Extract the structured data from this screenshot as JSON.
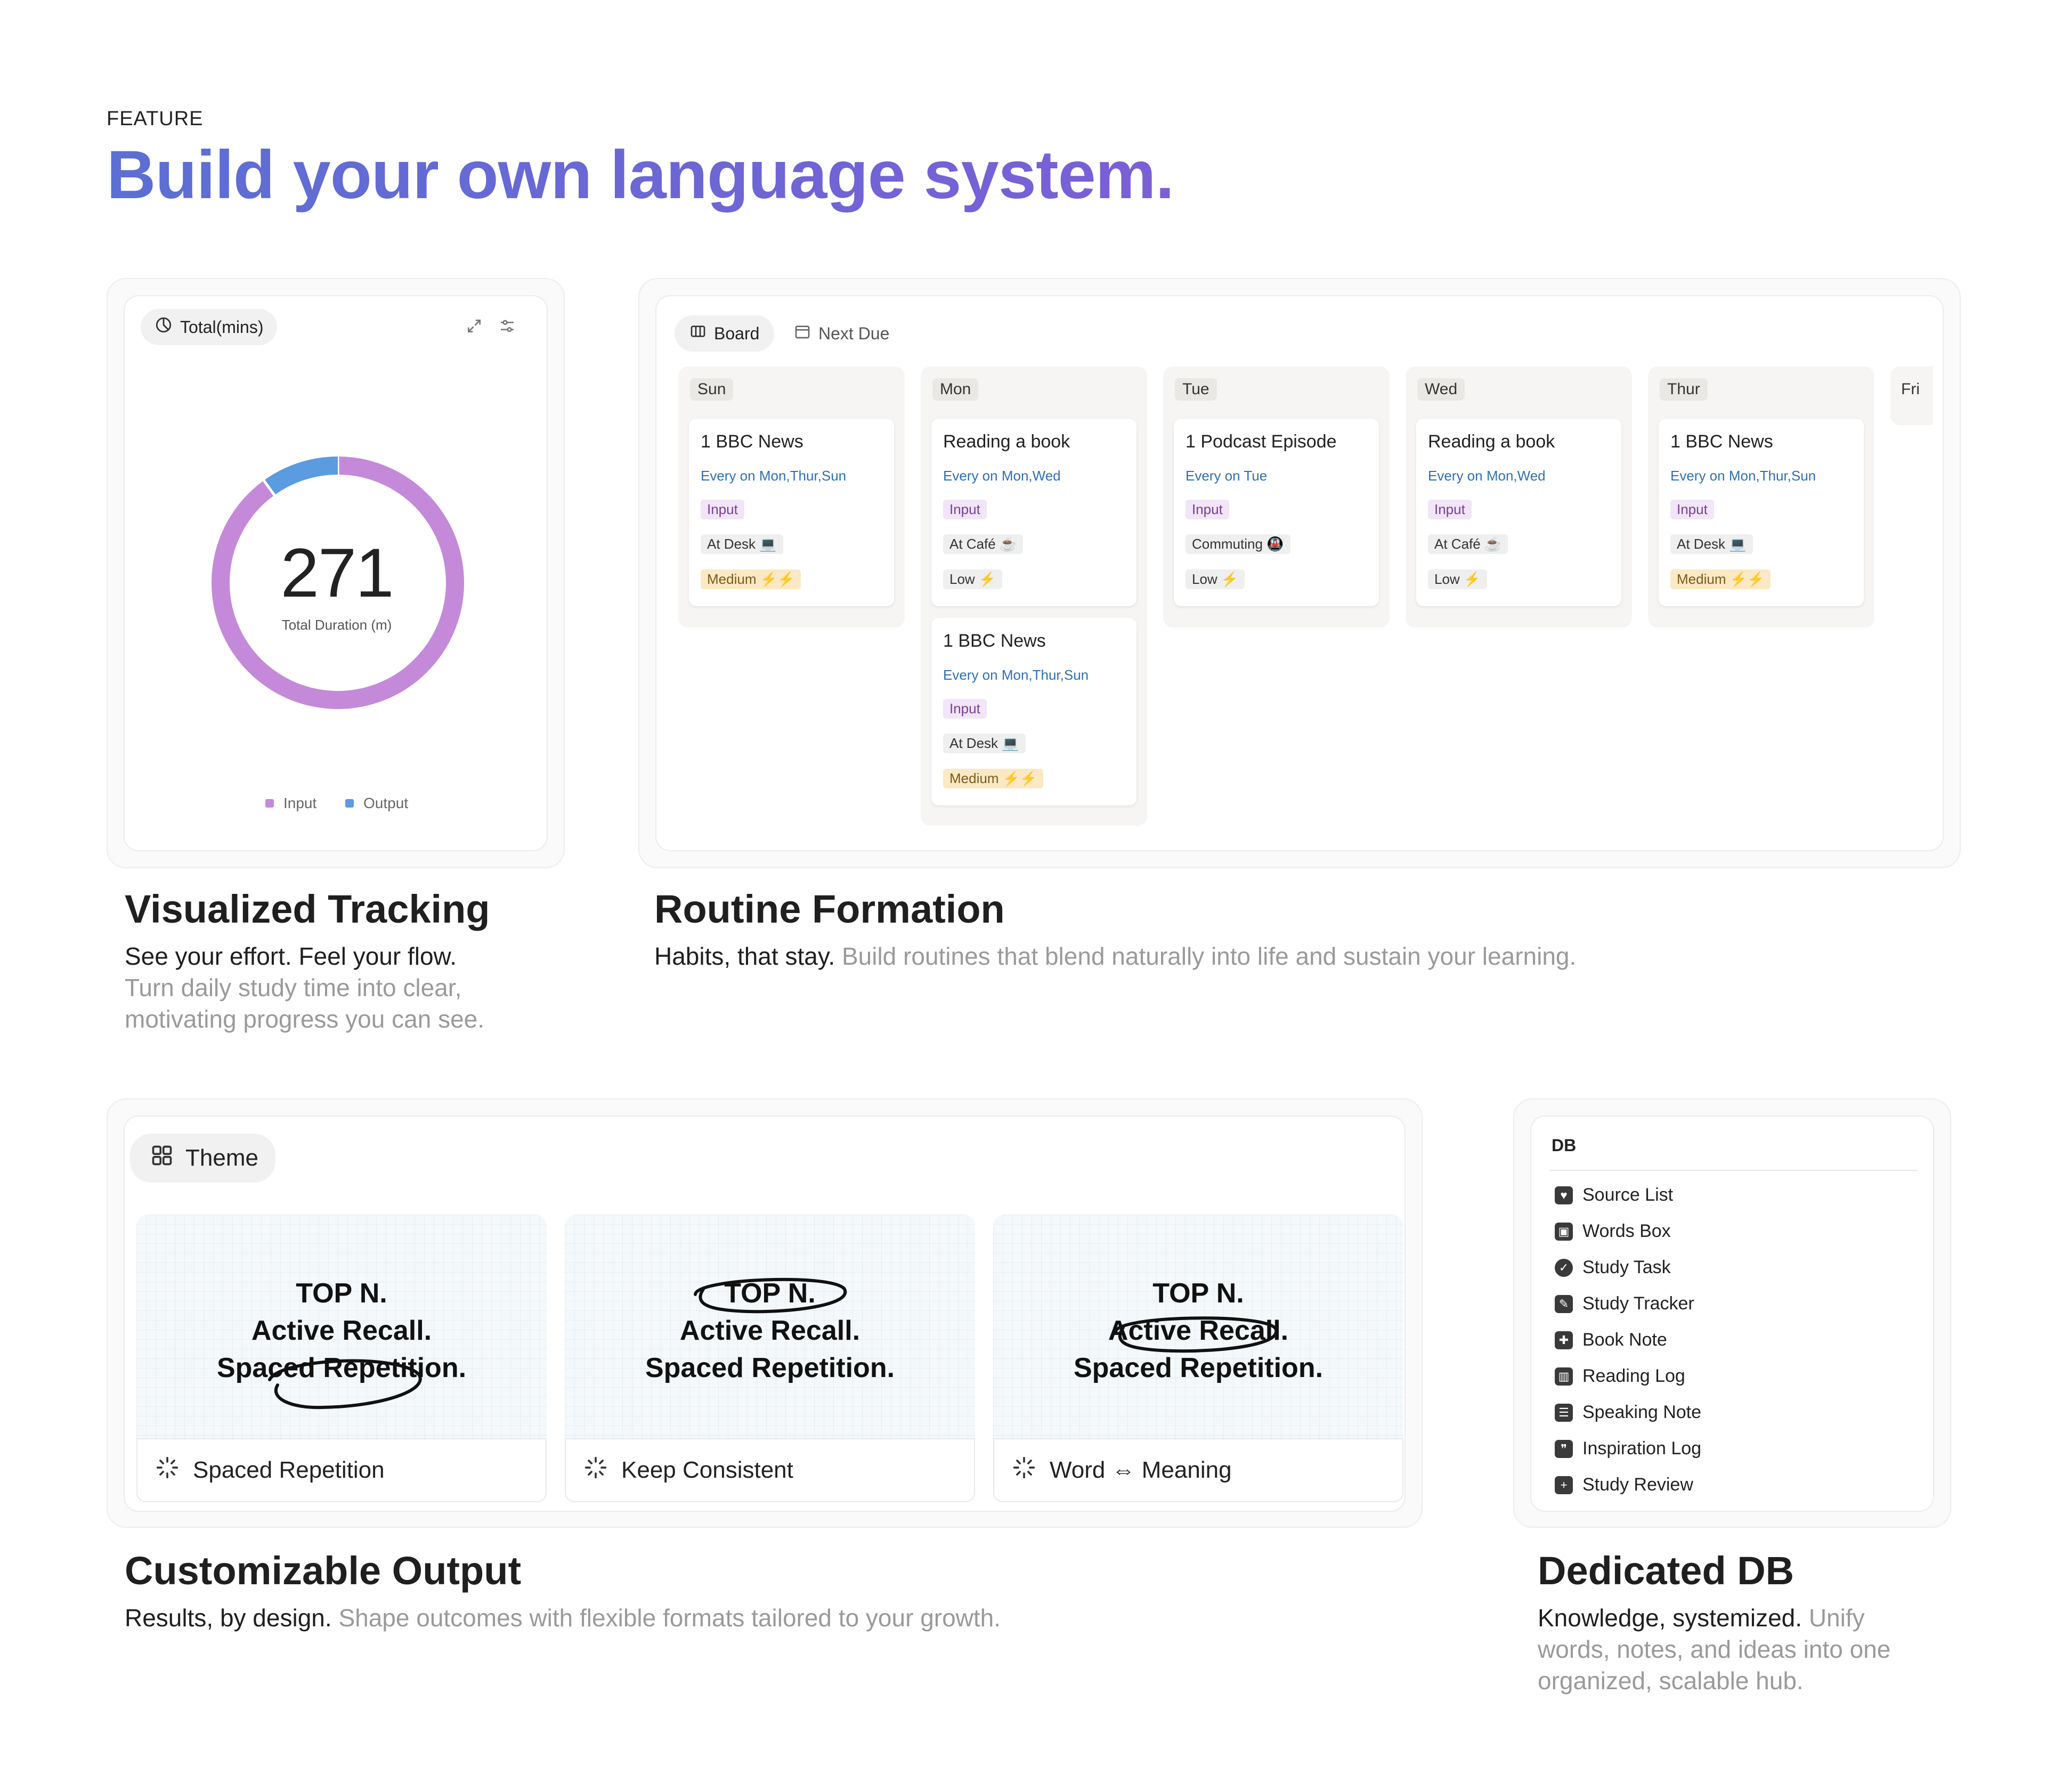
{
  "header": {
    "eyebrow": "FEATURE",
    "title": "Build your own language system."
  },
  "tracking": {
    "pill_label": "Total(mins)",
    "total_value": "271",
    "total_caption": "Total Duration (m)",
    "chart_data": {
      "type": "pie",
      "title": "",
      "categories": [
        "Input",
        "Output"
      ],
      "values": [
        244,
        27
      ],
      "colors": [
        "#c48ad9",
        "#5b9be0"
      ],
      "legend": "bottom",
      "total": 271
    },
    "legend": [
      {
        "label": "Input",
        "color": "#c48ad9"
      },
      {
        "label": "Output",
        "color": "#5b9be0"
      }
    ],
    "section_title": "Visualized Tracking",
    "lead": "See your effort. Feel your flow.",
    "body": "Turn daily study time into clear, motivating progress you can see."
  },
  "routine": {
    "tabs": [
      {
        "label": "Board",
        "active": true
      },
      {
        "label": "Next Due",
        "active": false
      }
    ],
    "columns": [
      {
        "day": "Sun",
        "cards": [
          {
            "title": "1 BBC News",
            "schedule": "Every on Mon,Thur,Sun",
            "type": "Input",
            "place": "At Desk 💻",
            "level": "Medium ⚡⚡",
            "level_kind": "med"
          }
        ]
      },
      {
        "day": "Mon",
        "cards": [
          {
            "title": "Reading a book",
            "schedule": "Every on Mon,Wed",
            "type": "Input",
            "place": "At Café ☕",
            "level": "Low ⚡",
            "level_kind": "low"
          },
          {
            "title": "1 BBC News",
            "schedule": "Every on Mon,Thur,Sun",
            "type": "Input",
            "place": "At Desk 💻",
            "level": "Medium ⚡⚡",
            "level_kind": "med"
          }
        ]
      },
      {
        "day": "Tue",
        "cards": [
          {
            "title": "1 Podcast Episode",
            "schedule": "Every on Tue",
            "type": "Input",
            "place": "Commuting 🚇",
            "level": "Low ⚡",
            "level_kind": "low"
          }
        ]
      },
      {
        "day": "Wed",
        "cards": [
          {
            "title": "Reading a book",
            "schedule": "Every on Mon,Wed",
            "type": "Input",
            "place": "At Café ☕",
            "level": "Low ⚡",
            "level_kind": "low"
          }
        ]
      },
      {
        "day": "Thur",
        "cards": [
          {
            "title": "1 BBC News",
            "schedule": "Every on Mon,Thur,Sun",
            "type": "Input",
            "place": "At Desk 💻",
            "level": "Medium ⚡⚡",
            "level_kind": "med"
          }
        ]
      }
    ],
    "partial_column": "Fri",
    "section_title": "Routine Formation",
    "lead": "Habits, that stay.",
    "body": "Build routines that blend naturally into life and sustain your learning."
  },
  "output": {
    "pill_label": "Theme",
    "themes": [
      {
        "lines": [
          "TOP N.",
          "Active Recall.",
          "Spaced Repetition."
        ],
        "label": "Spaced Repetition"
      },
      {
        "lines": [
          "TOP N.",
          "Active Recall.",
          "Spaced Repetition."
        ],
        "label": "Keep Consistent"
      },
      {
        "lines": [
          "TOP N.",
          "Active Recall.",
          "Spaced Repetition."
        ],
        "label": "Word ⇔ Meaning"
      }
    ],
    "section_title": "Customizable Output",
    "lead": "Results, by design.",
    "body": "Shape outcomes with flexible formats tailored to your growth."
  },
  "db": {
    "heading": "DB",
    "items": [
      {
        "label": "Source List",
        "icon": "heart-icon"
      },
      {
        "label": "Words Box",
        "icon": "box-icon"
      },
      {
        "label": "Study Task",
        "icon": "check-circle-icon"
      },
      {
        "label": "Study Tracker",
        "icon": "pencil-icon"
      },
      {
        "label": "Book Note",
        "icon": "bookmark-icon"
      },
      {
        "label": "Reading Log",
        "icon": "chart-icon"
      },
      {
        "label": "Speaking Note",
        "icon": "speech-icon"
      },
      {
        "label": "Inspiration Log",
        "icon": "quote-icon"
      },
      {
        "label": "Study Review",
        "icon": "plus-square-icon"
      }
    ],
    "section_title": "Dedicated DB",
    "lead": "Knowledge, systemized.",
    "body": "Unify words, notes, and ideas into one organized, scalable hub."
  }
}
